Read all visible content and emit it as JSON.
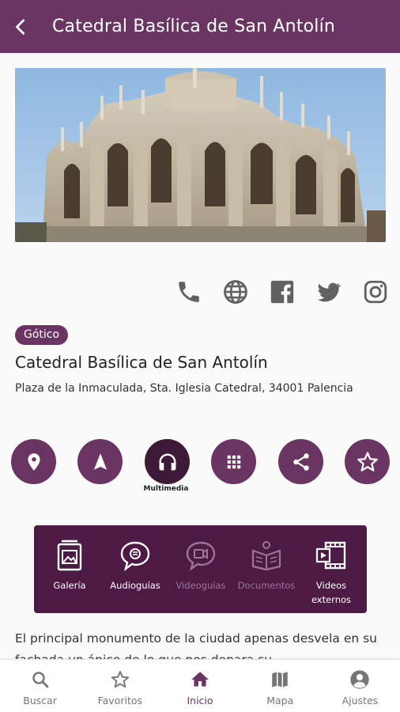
{
  "header": {
    "title": "Catedral Basílica de San  Antolín"
  },
  "place": {
    "style_chip": "Gótico",
    "title": "Catedral Basílica de San  Antolín",
    "address": "Plaza de la Inmaculada, Sta. Iglesia Catedral, 34001 Palencia"
  },
  "social": [
    "phone-icon",
    "globe-icon",
    "facebook-icon",
    "twitter-icon",
    "instagram-icon"
  ],
  "actions": {
    "items": [
      "location-pin-icon",
      "navigation-arrow-icon",
      "headphones-icon",
      "grid-apps-icon",
      "share-icon",
      "star-outline-icon"
    ],
    "active_label": "Multimedia"
  },
  "media": {
    "items": [
      {
        "label": "Galería",
        "enabled": true
      },
      {
        "label": "Audioguías",
        "enabled": true
      },
      {
        "label": "Videoguías",
        "enabled": false
      },
      {
        "label": "Documentos",
        "enabled": false
      },
      {
        "label": "Videos externos",
        "enabled": true
      }
    ]
  },
  "description": "El principal monumento de la ciudad apenas desvela en su fachada un ápice de lo que nos depara su",
  "nav": {
    "items": [
      {
        "label": "Buscar",
        "active": false
      },
      {
        "label": "Favoritos",
        "active": false
      },
      {
        "label": "Inicio",
        "active": true
      },
      {
        "label": "Mapa",
        "active": false
      },
      {
        "label": "Ajustes",
        "active": false
      }
    ]
  },
  "colors": {
    "primary": "#6a3562",
    "panel": "#4d1a45",
    "active_circle": "#3e1a38",
    "sky": "#9cc3e8"
  }
}
